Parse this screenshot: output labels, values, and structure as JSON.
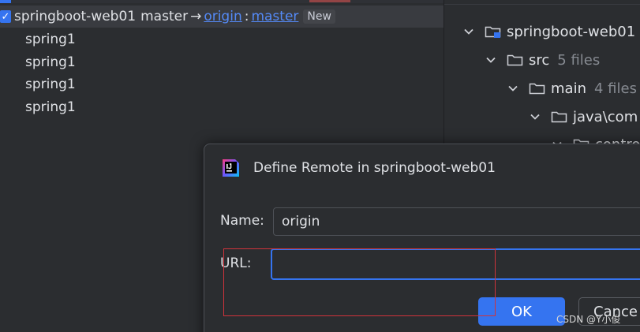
{
  "commit_panel": {
    "branch": {
      "repo": "springboot-web01",
      "local": "master",
      "arrow": "→",
      "remote": "origin",
      "separator": ":",
      "remote_branch": "master",
      "badge": "New"
    },
    "commits": [
      "spring1",
      "spring1",
      "spring1",
      "spring1"
    ]
  },
  "project_tree": {
    "items": [
      {
        "label": "springboot-web01",
        "count": "",
        "icon": "module-folder-icon"
      },
      {
        "label": "src",
        "count": "5 files",
        "icon": "folder-icon"
      },
      {
        "label": "main",
        "count": "4 files",
        "icon": "folder-icon"
      },
      {
        "label": "java\\com",
        "count": "",
        "icon": "folder-icon"
      },
      {
        "label": "contro",
        "count": "",
        "icon": "folder-icon"
      }
    ]
  },
  "dialog": {
    "title": "Define Remote in springboot-web01",
    "name_label": "Name:",
    "name_value": "origin",
    "url_label": "URL:",
    "url_value": "",
    "ok_label": "OK",
    "cancel_label": "Cance"
  },
  "watermark": "CSDN @Y小俊",
  "colors": {
    "accent": "#3574f0",
    "link": "#548af7",
    "annotation": "#d0333b"
  }
}
